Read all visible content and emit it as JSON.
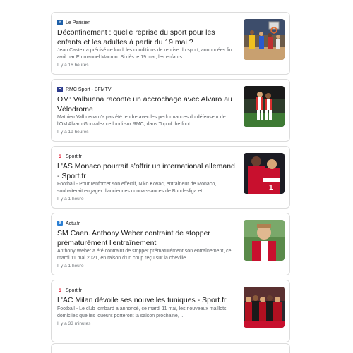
{
  "articles": [
    {
      "source": "Le Parisien",
      "logo": "le-parisien-logo",
      "logo_color": "#1d5fa8",
      "title": "Déconfinement : quelle reprise du sport pour les enfants et les adultes à partir du 19 mai ?",
      "snippet": "Jean Castex a précisé ce lundi les conditions de reprise du sport, annoncées fin avril par Emmanuel Macron. Si dès le 19 mai, les enfants ...",
      "time": "Il y a 16 heures"
    },
    {
      "source": "RMC Sport - BFMTV",
      "logo": "rmc-sport-logo",
      "logo_color": "#2b3a8c",
      "title": "OM: Valbuena raconte un accrochage avec Alvaro au Vélodrome",
      "snippet": "Mathieu Valbuena n'a pas été tendre avec les performances du défenseur de l'OM Alvaro Gonzalez ce lundi sur RMC, dans Top of the foot.",
      "time": "Il y a 19 heures"
    },
    {
      "source": "Sport.fr",
      "logo": "sport-fr-logo",
      "logo_color": "#e2001a",
      "title": "L'AS Monaco pourrait s'offrir un international allemand - Sport.fr",
      "snippet": "Football - Pour renforcer son effectif, Niko Kovac, entraîneur de Monaco, souhaiterait engager d'anciennes connaissances de Bundesliga et ...",
      "time": "Il y a 1 heure"
    },
    {
      "source": "Actu.fr",
      "logo": "actu-fr-logo",
      "logo_color": "#2a7fd4",
      "title": "SM Caen. Anthony Weber contraint de stopper prématurément l'entraînement",
      "snippet": "Anthony Weber a été contraint de stopper prématurément son entraînement, ce mardi 11 mai 2021, en raison d'un coup reçu sur la cheville.",
      "time": "Il y a 1 heure"
    },
    {
      "source": "Sport.fr",
      "logo": "sport-fr-logo",
      "logo_color": "#e2001a",
      "title": "L'AC Milan dévoile ses nouvelles tuniques - Sport.fr",
      "snippet": "Football - Le club lombard a annoncé, ce mardi 11 mai, les nouveaux maillots domiciles que les joueurs porteront la saison prochaine, ...",
      "time": "Il y a 33 minutes"
    }
  ]
}
